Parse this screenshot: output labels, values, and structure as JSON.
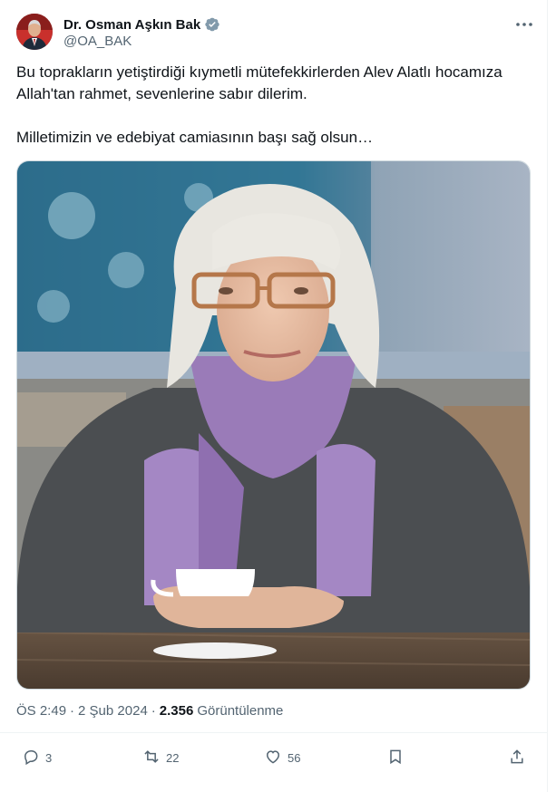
{
  "author": {
    "display_name": "Dr. Osman Aşkın Bak",
    "handle": "@OA_BAK"
  },
  "tweet": {
    "text_line1": "Bu toprakların yetiştirdiği kıymetli mütefekkirlerden Alev Alatlı hocamıza Allah'tan rahmet, sevenlerine sabır dilerim.",
    "text_line2": "Milletimizin ve edebiyat camiasının başı sağ olsun…"
  },
  "meta": {
    "time": "ÖS 2:49",
    "date": "2 Şub 2024",
    "views_count": "2.356",
    "views_label": "Görüntülenme"
  },
  "actions": {
    "replies": "3",
    "retweets": "22",
    "likes": "56"
  },
  "icons": [
    "verified-icon",
    "more-icon",
    "reply-icon",
    "retweet-icon",
    "like-icon",
    "bookmark-icon",
    "share-icon"
  ],
  "colors": {
    "verified_badge": "#829aab",
    "secondary_text": "#536471",
    "primary_text": "#0f1419"
  }
}
